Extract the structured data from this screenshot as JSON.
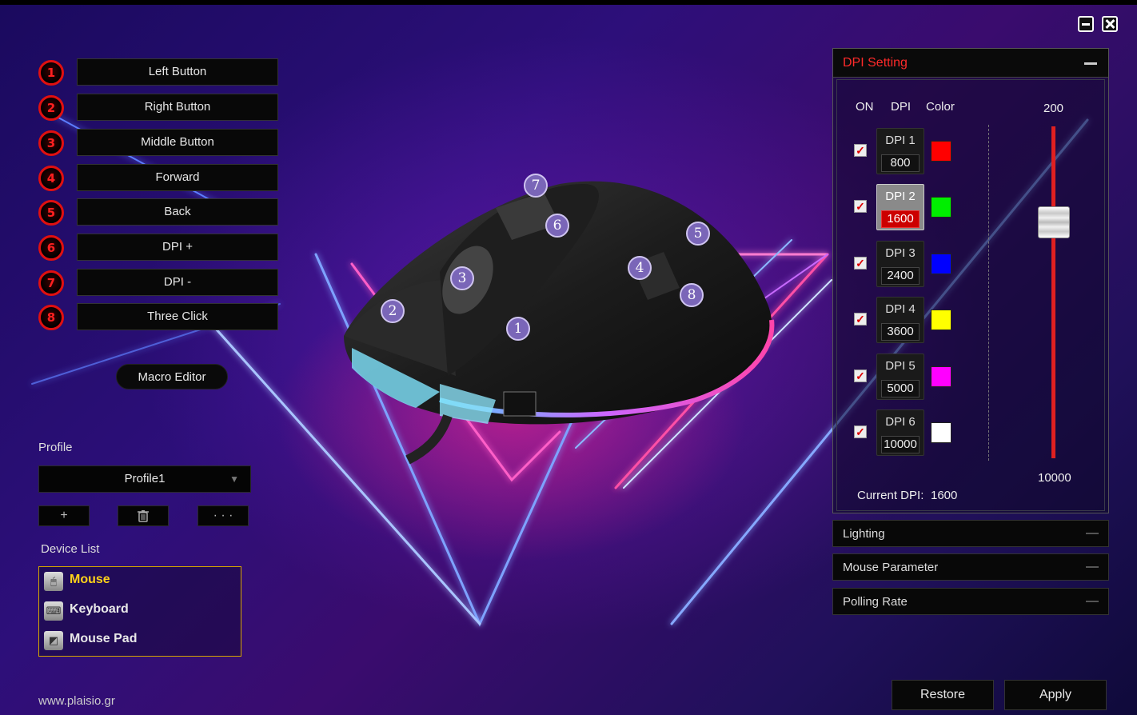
{
  "window": {
    "minimize_icon": "minimize-icon",
    "close_icon": "close-icon"
  },
  "buttons": [
    {
      "number": "1",
      "label": "Left Button"
    },
    {
      "number": "2",
      "label": "Right Button"
    },
    {
      "number": "3",
      "label": "Middle Button"
    },
    {
      "number": "4",
      "label": "Forward"
    },
    {
      "number": "5",
      "label": "Back"
    },
    {
      "number": "6",
      "label": "DPI +"
    },
    {
      "number": "7",
      "label": "DPI -"
    },
    {
      "number": "8",
      "label": "Three Click"
    }
  ],
  "macro_editor_label": "Macro Editor",
  "profile": {
    "heading": "Profile",
    "selected": "Profile1",
    "add_label": "+",
    "delete_icon": "trash-icon",
    "more_label": "· · ·"
  },
  "device_list": {
    "heading": "Device List",
    "items": [
      {
        "label": "Mouse",
        "icon": "mouse-icon",
        "active": true
      },
      {
        "label": "Keyboard",
        "icon": "keyboard-icon",
        "active": false
      },
      {
        "label": "Mouse Pad",
        "icon": "mouse-pad-icon",
        "active": false
      }
    ]
  },
  "footer_site": "www.plaisio.gr",
  "mouse_callouts": [
    "1",
    "2",
    "3",
    "4",
    "5",
    "6",
    "7",
    "8"
  ],
  "dpi_panel": {
    "title": "DPI Setting",
    "col_on": "ON",
    "col_dpi": "DPI",
    "col_color": "Color",
    "levels": [
      {
        "name": "DPI 1",
        "value": "800",
        "color": "#ff0000",
        "on": true,
        "selected": false
      },
      {
        "name": "DPI 2",
        "value": "1600",
        "color": "#00ee00",
        "on": true,
        "selected": true
      },
      {
        "name": "DPI 3",
        "value": "2400",
        "color": "#0000ff",
        "on": true,
        "selected": false
      },
      {
        "name": "DPI 4",
        "value": "3600",
        "color": "#ffff00",
        "on": true,
        "selected": false
      },
      {
        "name": "DPI 5",
        "value": "5000",
        "color": "#ff00ff",
        "on": true,
        "selected": false
      },
      {
        "name": "DPI 6",
        "value": "10000",
        "color": "#ffffff",
        "on": true,
        "selected": false
      }
    ],
    "slider_min_label": "200",
    "slider_max_label": "10000",
    "current_label": "Current DPI:",
    "current_value": "1600"
  },
  "sections": [
    {
      "label": "Lighting"
    },
    {
      "label": "Mouse Parameter"
    },
    {
      "label": "Polling Rate"
    }
  ],
  "actions": {
    "restore": "Restore",
    "apply": "Apply"
  },
  "accent_colors": {
    "badge_red": "#e01010",
    "active_device": "#ffd21a",
    "dpi_title": "#ff2a2a"
  }
}
